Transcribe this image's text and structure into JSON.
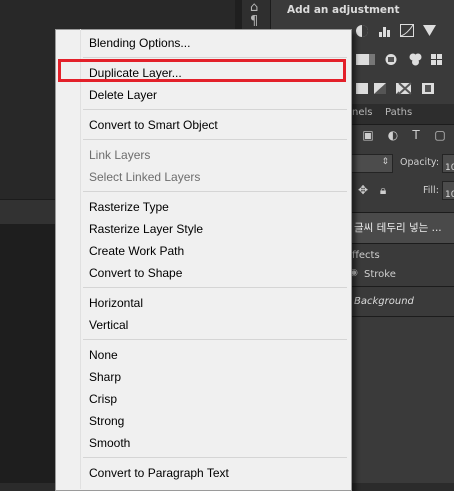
{
  "adjustments_panel": {
    "title": "Add an adjustment"
  },
  "panel_tabs": {
    "channels_partial": "nels",
    "paths": "Paths"
  },
  "layers_panel": {
    "opacity_label": "Opacity:",
    "opacity_value": "10",
    "fill_label": "Fill:",
    "fill_value": "10",
    "layer_name": "글씨 테두리 넣는 ...",
    "effects_label": "ffects",
    "stroke_label": "Stroke",
    "background_label": "Background"
  },
  "context_menu": {
    "items": [
      {
        "label": "Blending Options...",
        "enabled": true
      },
      {
        "label": "Duplicate Layer...",
        "enabled": true,
        "highlighted": true
      },
      {
        "label": "Delete Layer",
        "enabled": true
      },
      {
        "label": "Convert to Smart Object",
        "enabled": true
      },
      {
        "label": "Link Layers",
        "enabled": false
      },
      {
        "label": "Select Linked Layers",
        "enabled": false
      },
      {
        "label": "Rasterize Type",
        "enabled": true
      },
      {
        "label": "Rasterize Layer Style",
        "enabled": true
      },
      {
        "label": "Create Work Path",
        "enabled": true
      },
      {
        "label": "Convert to Shape",
        "enabled": true
      },
      {
        "label": "Horizontal",
        "enabled": true
      },
      {
        "label": "Vertical",
        "enabled": true
      },
      {
        "label": "None",
        "enabled": true
      },
      {
        "label": "Sharp",
        "enabled": true
      },
      {
        "label": "Crisp",
        "enabled": true
      },
      {
        "label": "Strong",
        "enabled": true
      },
      {
        "label": "Smooth",
        "enabled": true
      },
      {
        "label": "Convert to Paragraph Text",
        "enabled": true
      }
    ]
  },
  "colors": {
    "highlight_border": "#e3202a",
    "menu_background": "#f0f0f0",
    "disabled_text": "#6d6d6d"
  }
}
